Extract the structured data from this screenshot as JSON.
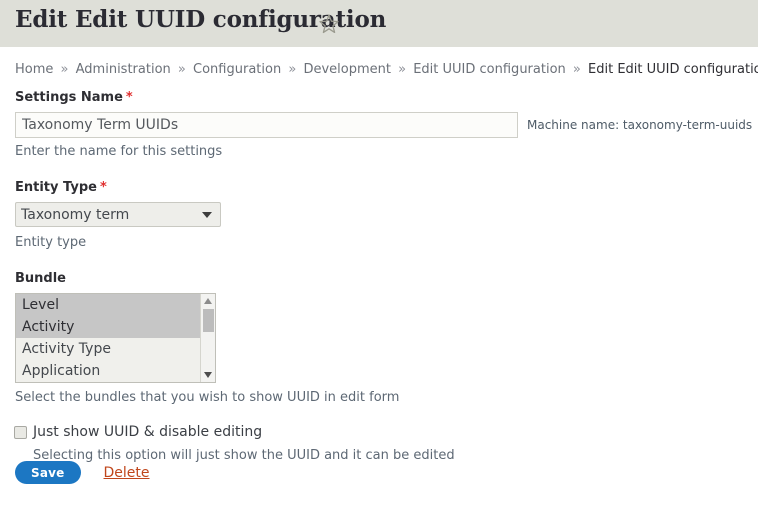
{
  "header": {
    "title": "Edit Edit UUID configuration",
    "star_icon": "star-outline-icon"
  },
  "breadcrumb": {
    "separator": "»",
    "items": [
      {
        "label": "Home",
        "current": false
      },
      {
        "label": "Administration",
        "current": false
      },
      {
        "label": "Configuration",
        "current": false
      },
      {
        "label": "Development",
        "current": false
      },
      {
        "label": "Edit UUID configuration",
        "current": false
      },
      {
        "label": "Edit Edit UUID configuration",
        "current": true
      }
    ]
  },
  "form": {
    "settings_name": {
      "label": "Settings Name",
      "required_marker": "*",
      "value": "Taxonomy Term UUIDs",
      "placeholder": "",
      "machine_name": "Machine name: taxonomy-term-uuids",
      "description": "Enter the name for this settings"
    },
    "entity_type": {
      "label": "Entity Type",
      "required_marker": "*",
      "selected": "Taxonomy term",
      "options": [
        "Taxonomy term"
      ],
      "description": "Entity type"
    },
    "bundle": {
      "label": "Bundle",
      "options": [
        {
          "label": "Level",
          "selected": true
        },
        {
          "label": "Activity",
          "selected": true
        },
        {
          "label": "Activity Type",
          "selected": false
        },
        {
          "label": "Application",
          "selected": false
        }
      ],
      "description": "Select the bundles that you wish to show UUID in edit form"
    },
    "just_show_uuid": {
      "label": "Just show UUID & disable editing",
      "checked": false,
      "description": "Selecting this option will just show the UUID and it can be edited"
    }
  },
  "actions": {
    "save_label": "Save",
    "delete_label": "Delete"
  },
  "colors": {
    "header_band": "#dedfd8",
    "required_red": "#e02f2f",
    "save_blue": "#1c77c3",
    "delete_orange": "#c0461b",
    "selection_grey": "#c6c6c6"
  }
}
